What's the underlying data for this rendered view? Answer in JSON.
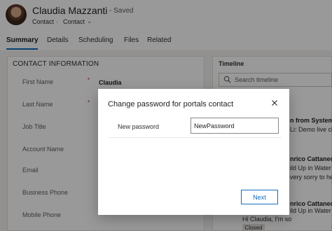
{
  "record": {
    "name": "Claudia Mazzanti",
    "saved_status": "- Saved",
    "entity_type": "Contact",
    "separator": "·",
    "form_selector": "Contact"
  },
  "tabs": [
    {
      "label": "Summary",
      "active": true
    },
    {
      "label": "Details",
      "active": false
    },
    {
      "label": "Scheduling",
      "active": false
    },
    {
      "label": "Files",
      "active": false
    },
    {
      "label": "Related",
      "active": false
    }
  ],
  "contact_section": {
    "title": "CONTACT INFORMATION",
    "fields": [
      {
        "label": "First Name",
        "required": true,
        "value": "Claudia"
      },
      {
        "label": "Last Name",
        "required": true,
        "value": ""
      },
      {
        "label": "Job Title",
        "required": false,
        "value": ""
      },
      {
        "label": "Account Name",
        "required": false,
        "value": ""
      },
      {
        "label": "Email",
        "required": false,
        "value": ""
      },
      {
        "label": "Business Phone",
        "required": false,
        "value": ""
      },
      {
        "label": "Mobile Phone",
        "required": false,
        "value": ""
      }
    ]
  },
  "timeline": {
    "title": "Timeline",
    "search_placeholder": "Search timeline",
    "fragments": [
      "n from System A",
      "Li: Demo live cha",
      "nrico Cattaneo",
      "ild Up in Water",
      "very sorry to hea",
      "nrico Cattaneo",
      "ild Up in Water",
      "Hi Claudia, I'm so"
    ],
    "badge": "Closed"
  },
  "dialog": {
    "title": "Change password for portals contact",
    "field_label": "New password",
    "field_value": "NewPassword",
    "next_label": "Next"
  },
  "colors": {
    "accent": "#0f6cbd",
    "required": "#a4262c",
    "overlay": "rgba(0,0,0,0.4)"
  }
}
